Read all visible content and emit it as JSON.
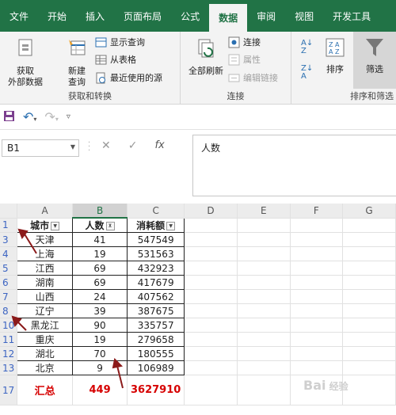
{
  "ribbon_tabs": [
    "文件",
    "开始",
    "插入",
    "页面布局",
    "公式",
    "数据",
    "审阅",
    "视图",
    "开发工具"
  ],
  "active_tab": "数据",
  "groups": {
    "get_transform": {
      "get_external": "获取\n外部数据",
      "new_query": "新建\n查询",
      "show_query": "显示查询",
      "from_table": "从表格",
      "recent_sources": "最近使用的源",
      "label": "获取和转换"
    },
    "connections": {
      "refresh_all": "全部刷新",
      "connections": "连接",
      "properties": "属性",
      "edit_links": "编辑链接",
      "label": "连接"
    },
    "sort_filter": {
      "sort": "排序",
      "filter": "筛选",
      "label": "排序和筛选"
    }
  },
  "name_box": "B1",
  "formula_bar": "人数",
  "columns": [
    "A",
    "B",
    "C",
    "D",
    "E",
    "F",
    "G"
  ],
  "selected_column": "B",
  "headers": [
    "城市",
    "人数",
    "消耗额"
  ],
  "rows": [
    {
      "row": "1",
      "city": "",
      "count": "",
      "amount": ""
    },
    {
      "row": "3",
      "city": "天津",
      "count": "41",
      "amount": "547549"
    },
    {
      "row": "4",
      "city": "上海",
      "count": "19",
      "amount": "531563"
    },
    {
      "row": "5",
      "city": "江西",
      "count": "69",
      "amount": "432923"
    },
    {
      "row": "6",
      "city": "湖南",
      "count": "69",
      "amount": "417679"
    },
    {
      "row": "7",
      "city": "山西",
      "count": "24",
      "amount": "407562"
    },
    {
      "row": "8",
      "city": "辽宁",
      "count": "39",
      "amount": "387675"
    },
    {
      "row": "10",
      "city": "黑龙江",
      "count": "90",
      "amount": "335757"
    },
    {
      "row": "11",
      "city": "重庆",
      "count": "19",
      "amount": "279658"
    },
    {
      "row": "12",
      "city": "湖北",
      "count": "70",
      "amount": "180555"
    },
    {
      "row": "13",
      "city": "北京",
      "count": "9",
      "amount": "106989"
    }
  ],
  "total_row": {
    "row": "17",
    "label": "汇总",
    "count": "449",
    "amount": "3627910"
  },
  "watermark": "Bai 经验",
  "colors": {
    "accent": "#217346",
    "total": "#d60000",
    "arrow": "#8b1a1a"
  }
}
